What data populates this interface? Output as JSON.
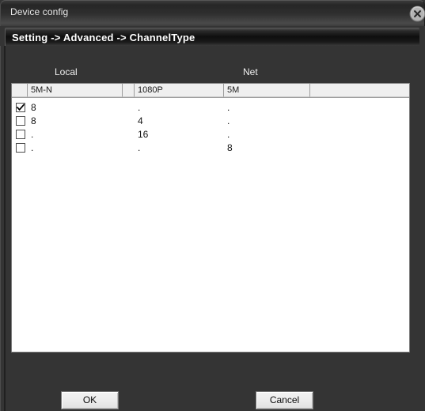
{
  "window": {
    "title": "Device config",
    "close_icon": "close-circle-icon"
  },
  "breadcrumb": {
    "text": "Setting -> Advanced -> ChannelType"
  },
  "groups": {
    "local_label": "Local",
    "net_label": "Net"
  },
  "table": {
    "headers": [
      "",
      "5M-N",
      "",
      "1080P",
      "5M",
      ""
    ],
    "rows": [
      {
        "selected": true,
        "c0": "8",
        "c1": ".",
        "c2": "."
      },
      {
        "selected": false,
        "c0": "8",
        "c1": "4",
        "c2": "."
      },
      {
        "selected": false,
        "c0": ".",
        "c1": "16",
        "c2": "."
      },
      {
        "selected": false,
        "c0": ".",
        "c1": ".",
        "c2": "8"
      }
    ]
  },
  "footer": {
    "ok_label": "OK",
    "cancel_label": "Cancel"
  },
  "colors": {
    "window_bg": "#343434",
    "titlebar_text": "#e9e9e9",
    "breadcrumb_text": "#ffffff",
    "table_bg": "#ffffff",
    "header_bg": "#efefef"
  }
}
